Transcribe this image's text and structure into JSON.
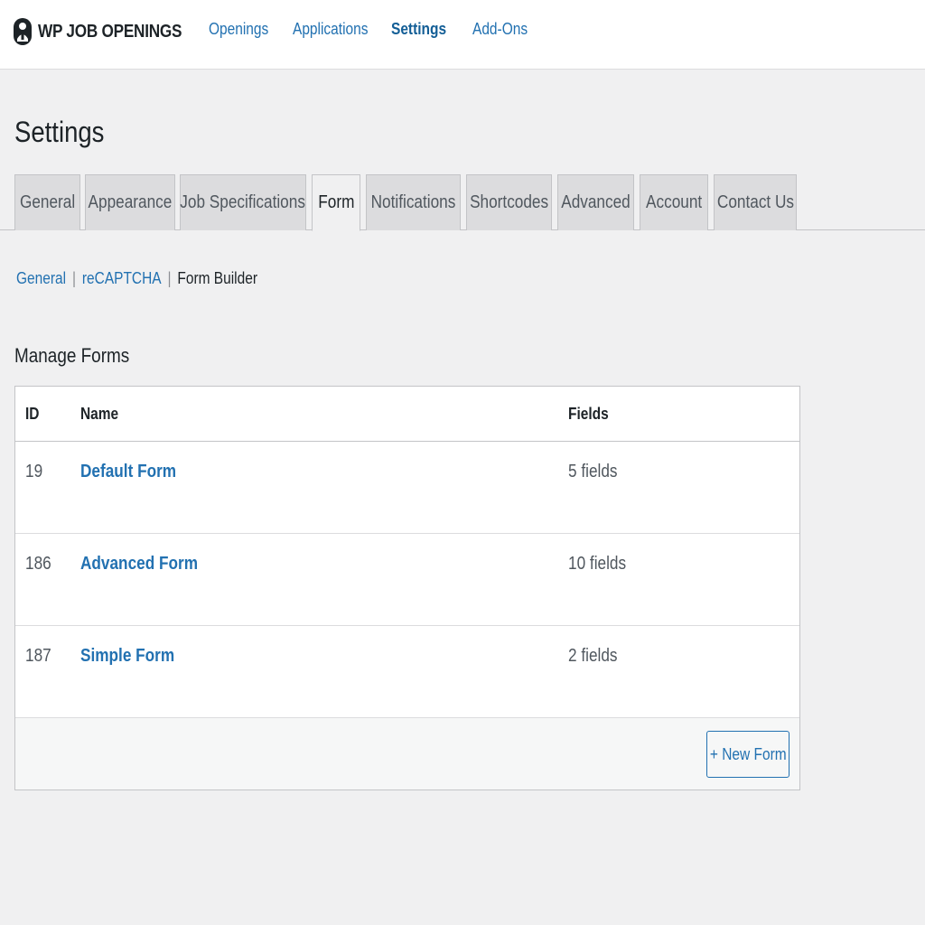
{
  "brand": {
    "name": "WP JOB OPENINGS",
    "logo_icon": "person-logo-icon"
  },
  "topnav": {
    "items": [
      {
        "label": "Openings",
        "active": false
      },
      {
        "label": "Applications",
        "active": false
      },
      {
        "label": "Settings",
        "active": true
      },
      {
        "label": "Add-Ons",
        "active": false
      }
    ]
  },
  "page": {
    "title": "Settings"
  },
  "tabs": [
    {
      "label": "General",
      "active": false
    },
    {
      "label": "Appearance",
      "active": false
    },
    {
      "label": "Job Specifications",
      "active": false
    },
    {
      "label": "Form",
      "active": true
    },
    {
      "label": "Notifications",
      "active": false
    },
    {
      "label": "Shortcodes",
      "active": false
    },
    {
      "label": "Advanced",
      "active": false
    },
    {
      "label": "Account",
      "active": false
    },
    {
      "label": "Contact Us",
      "active": false
    }
  ],
  "subnav": {
    "items": [
      {
        "label": "General",
        "current": false
      },
      {
        "label": "reCAPTCHA",
        "current": false
      },
      {
        "label": "Form Builder",
        "current": true
      }
    ],
    "separator": "|"
  },
  "manage_forms": {
    "heading": "Manage Forms",
    "columns": {
      "id": "ID",
      "name": "Name",
      "fields": "Fields"
    },
    "rows": [
      {
        "id": "19",
        "name": "Default Form",
        "fields": "5 fields"
      },
      {
        "id": "186",
        "name": "Advanced Form",
        "fields": "10 fields"
      },
      {
        "id": "187",
        "name": "Simple Form",
        "fields": "2 fields"
      }
    ],
    "new_button_label": "+ New Form"
  },
  "colors": {
    "link": "#2271b1",
    "background": "#f0f0f1",
    "tab_inactive": "#dcdcde",
    "text": "#1d2327"
  }
}
